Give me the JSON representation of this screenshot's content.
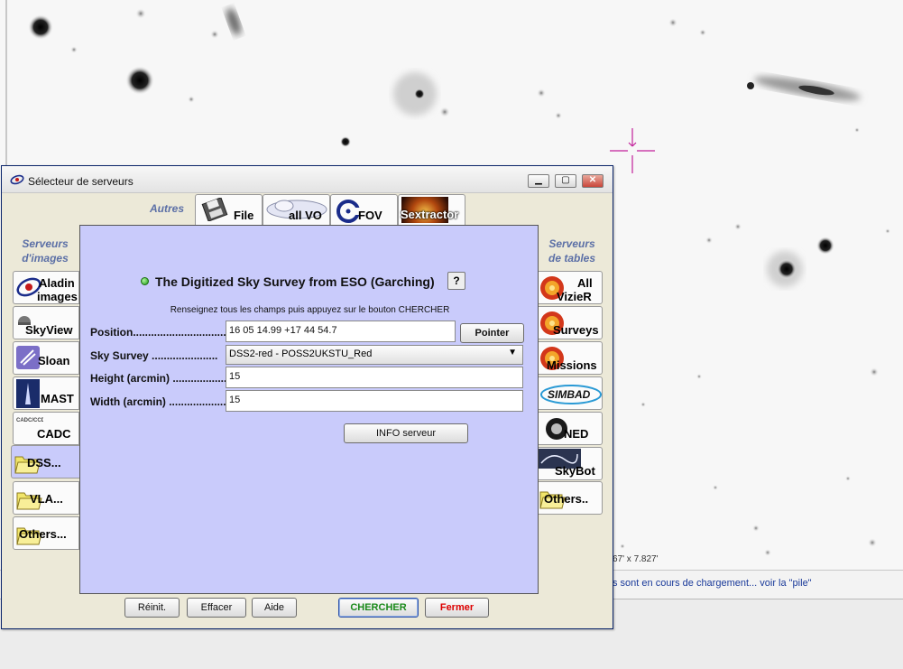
{
  "dialog": {
    "title": "Sélecteur de serveurs",
    "top_tabs_label": "Autres",
    "top_tabs": [
      "File",
      "all VO",
      "FOV",
      "Sextractor"
    ],
    "left_header": "Serveurs\nd'images",
    "left_buttons": [
      {
        "line1": "Aladin",
        "line2": "images"
      },
      {
        "line1": "SkyView"
      },
      {
        "line1": "Sloan"
      },
      {
        "line1": "MAST"
      },
      {
        "line1": "CADC"
      },
      {
        "line1": "DSS..."
      },
      {
        "line1": "VLA..."
      },
      {
        "line1": "Others..."
      }
    ],
    "right_header": "Serveurs\nde tables",
    "right_buttons": [
      {
        "line1": "All",
        "line2": "VizieR"
      },
      {
        "line1": "Surveys"
      },
      {
        "line1": "Missions"
      },
      {
        "line1": "SIMBAD"
      },
      {
        "line1": "NED"
      },
      {
        "line1": "SkyBot"
      },
      {
        "line1": "Others.."
      }
    ],
    "panel": {
      "survey_title": "The Digitized Sky Survey from ESO (Garching)",
      "help_label": "?",
      "instructions": "Renseignez tous les champs puis appuyez sur le bouton CHERCHER",
      "position_label": "Position.....................................",
      "position_value": "16 05 14.99 +17 44 54.7",
      "pointer_button": "Pointer",
      "survey_label": "Sky Survey ......................",
      "survey_value": "DSS2-red - POSS2UKSTU_Red",
      "height_label": "Height (arcmin) ....................",
      "height_value": "15",
      "width_label": "Width (arcmin) ......................",
      "width_value": "15",
      "info_button": "INFO serveur"
    },
    "bottom_buttons": {
      "reset": "Réinit.",
      "clear": "Effacer",
      "help": "Aide",
      "search": "CHERCHER",
      "close": "Fermer"
    }
  },
  "background": {
    "fov_text": "67' x 7.827'",
    "status_text": "s sont en cours de chargement... voir la \"pile\""
  },
  "colors": {
    "panel_bg": "#c9cbfb",
    "header_text": "#5b6fa6",
    "search_text": "#1a8a1a",
    "close_text": "#dd0000"
  }
}
